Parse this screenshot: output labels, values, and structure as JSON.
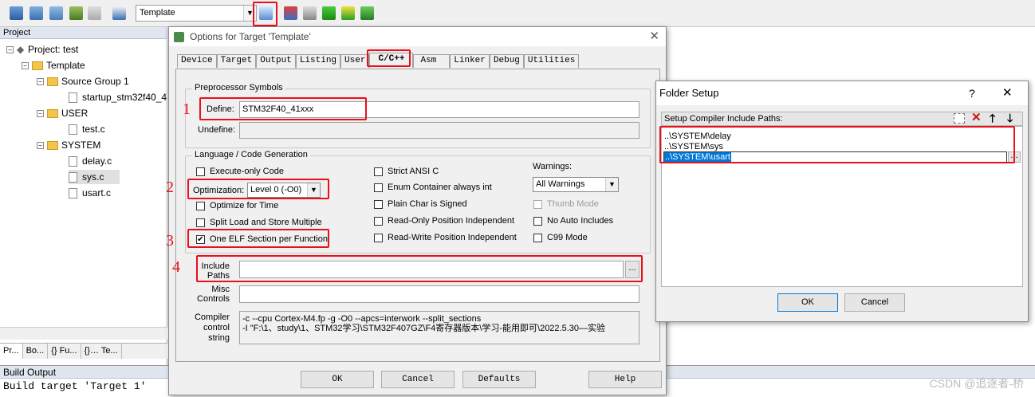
{
  "toolbar": {
    "target_select": "Template",
    "icons": [
      "translate-icon",
      "build-icon",
      "rebuild-icon",
      "batch-build-icon",
      "stop-build-icon",
      "download-icon",
      "options-for-target-icon",
      "manage-project-items-icon",
      "select-packs-icon",
      "manage-runtime-icon",
      "pack-installer-icon",
      "manage-multi-project-icon"
    ]
  },
  "project": {
    "title": "Project",
    "root": "Project: test",
    "target": "Template",
    "groups": [
      {
        "name": "Source Group 1",
        "files": [
          "startup_stm32f40_4"
        ]
      },
      {
        "name": "USER",
        "files": [
          "test.c"
        ]
      },
      {
        "name": "SYSTEM",
        "files": [
          "delay.c",
          "sys.c",
          "usart.c"
        ]
      }
    ],
    "tabs": [
      "Pr...",
      "Bo...",
      "{} Fu...",
      "{}… Te..."
    ]
  },
  "build_output": {
    "title": "Build Output",
    "text": "Build target 'Target 1'"
  },
  "options_dialog": {
    "title": "Options for Target 'Template'",
    "tabs": [
      "Device",
      "Target",
      "Output",
      "Listing",
      "User",
      "C/C++",
      "Asm",
      "Linker",
      "Debug",
      "Utilities"
    ],
    "active_tab": "C/C++",
    "preprocessor_label": "Preprocessor Symbols",
    "define_label": "Define:",
    "define_value": "STM32F40_41xxx",
    "undefine_label": "Undefine:",
    "undefine_value": "",
    "language_label": "Language / Code Generation",
    "execute_only": "Execute-only Code",
    "optimization_label": "Optimization:",
    "optimization_value": "Level 0 (-O0)",
    "optimize_time": "Optimize for Time",
    "split_load": "Split Load and Store Multiple",
    "one_elf": "One ELF Section per Function",
    "strict_ansi": "Strict ANSI C",
    "enum_container": "Enum Container always int",
    "plain_char": "Plain Char is Signed",
    "ro_pos": "Read-Only Position Independent",
    "rw_pos": "Read-Write Position Independent",
    "warnings_label": "Warnings:",
    "warnings_value": "All Warnings",
    "thumb_mode": "Thumb Mode",
    "no_auto_includes": "No Auto Includes",
    "c99_mode": "C99 Mode",
    "include_paths_label": "Include Paths",
    "include_paths_value": "",
    "browse": "...",
    "misc_controls_label": "Misc Controls",
    "misc_controls_value": "",
    "compiler_control_label": "Compiler control string",
    "compiler_control_line1": "-c --cpu Cortex-M4.fp -g -O0 --apcs=interwork --split_sections",
    "compiler_control_line2": "-I \"F:\\1、study\\1、STM32学习\\STM32F407GZ\\F4寄存器版本\\学习-能用即可\\2022.5.30—实验",
    "ok": "OK",
    "cancel": "Cancel",
    "defaults": "Defaults",
    "help": "Help",
    "checked": {
      "one_elf": true
    },
    "markers": [
      "1",
      "2",
      "3",
      "4"
    ]
  },
  "folder_setup": {
    "title": "Folder Setup",
    "help_glyph": "?",
    "close_glyph": "✕",
    "list_header": "Setup Compiler Include Paths:",
    "paths": [
      "..\\SYSTEM\\delay",
      "..\\SYSTEM\\sys",
      "..\\SYSTEM\\usart"
    ],
    "selected_index": 2,
    "browse": "...",
    "ok": "OK",
    "cancel": "Cancel"
  },
  "watermark": "CSDN @追逐者-桥",
  "colors": {
    "highlight_red": "#e8101a",
    "selection_blue": "#0078d7"
  }
}
